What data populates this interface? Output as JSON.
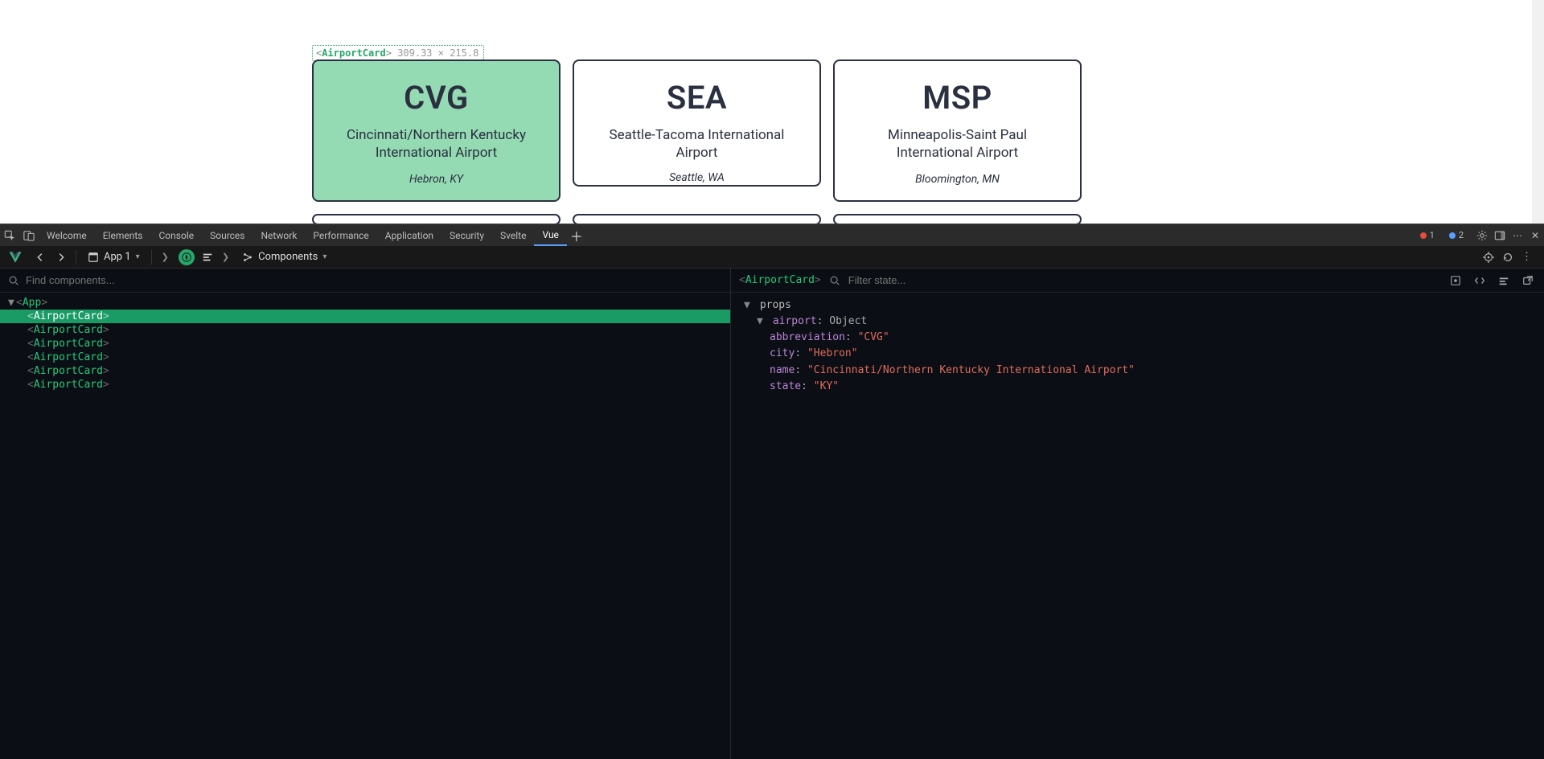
{
  "inspect_overlay": {
    "component": "AirportCard",
    "dimensions": "309.33 × 215.8"
  },
  "page": {
    "cards": [
      {
        "abbr": "CVG",
        "name": "Cincinnati/Northern Kentucky International Airport",
        "loc": "Hebron, KY",
        "selected": true
      },
      {
        "abbr": "SEA",
        "name": "Seattle-Tacoma International Airport",
        "loc": "Seattle, WA",
        "selected": false
      },
      {
        "abbr": "MSP",
        "name": "Minneapolis-Saint Paul International Airport",
        "loc": "Bloomington, MN",
        "selected": false
      }
    ]
  },
  "devtools": {
    "tabs": [
      "Welcome",
      "Elements",
      "Console",
      "Sources",
      "Network",
      "Performance",
      "Application",
      "Security",
      "Svelte",
      "Vue"
    ],
    "active_tab": "Vue",
    "errors": "1",
    "issues": "2"
  },
  "vuebar": {
    "app_label": "App 1",
    "view_label": "Components"
  },
  "left": {
    "search_placeholder": "Find components...",
    "tree": {
      "root": "App",
      "children": [
        "AirportCard",
        "AirportCard",
        "AirportCard",
        "AirportCard",
        "AirportCard",
        "AirportCard"
      ],
      "selected_index": 0
    }
  },
  "right": {
    "selected_component": "AirportCard",
    "filter_placeholder": "Filter state...",
    "props_label": "props",
    "airport_key": "airport",
    "airport_type": "Object",
    "props": {
      "abbreviation": "CVG",
      "city": "Hebron",
      "name": "Cincinnati/Northern Kentucky International Airport",
      "state": "KY"
    }
  }
}
